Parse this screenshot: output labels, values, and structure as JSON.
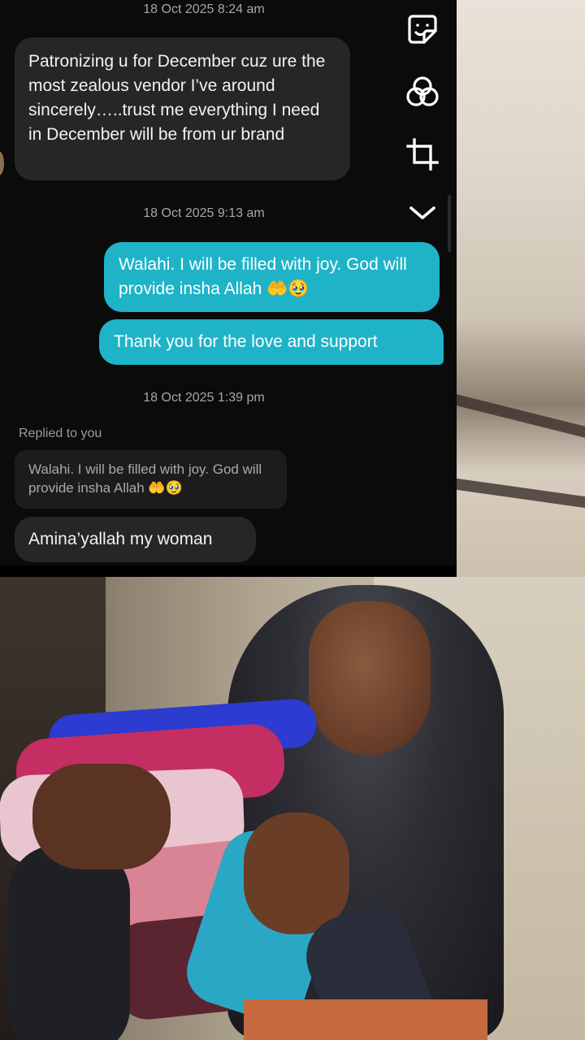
{
  "chat": {
    "timestamps": [
      "18 Oct 2025 8:24 am",
      "18 Oct 2025 9:13 am",
      "18 Oct 2025 1:39 pm"
    ],
    "messages": [
      {
        "sender": "them",
        "text": "Patronizing u for December cuz ure the most zealous vendor I’ve around sincerely…..trust me everything I need in December will be from ur brand"
      },
      {
        "sender": "me",
        "text": "Walahi. I will be filled with joy. God will provide insha Allah 🤲🥹"
      },
      {
        "sender": "me",
        "text": "Thank you for the love and support"
      },
      {
        "sender": "them",
        "text": "Amina’yallah my woman"
      }
    ],
    "reply_label": "Replied to you",
    "reply_quote": "Walahi. I will be filled with joy. God will provide insha Allah 🤲🥹",
    "colors": {
      "outgoing_bubble": "#1fb3c8",
      "incoming_bubble": "#262626",
      "background": "#0b0b0b"
    }
  },
  "toolbar": {
    "icons": [
      "sticker-icon",
      "color-filter-icon",
      "crop-icon",
      "chevron-down-icon"
    ]
  }
}
